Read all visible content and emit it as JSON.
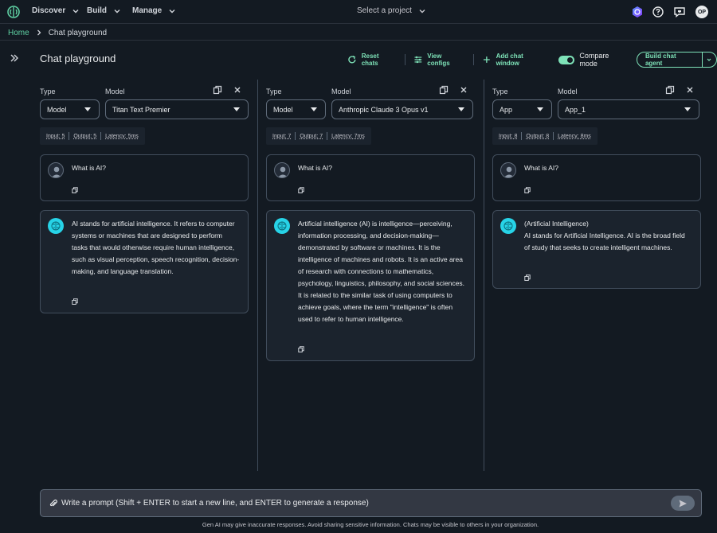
{
  "topnav": {
    "nav_items": [
      {
        "label": "Discover"
      },
      {
        "label": "Build"
      },
      {
        "label": "Manage"
      }
    ],
    "project_select": "Select a project",
    "user_initials": "OP",
    "icons": [
      "logo-icon",
      "shield-badge-icon",
      "help-icon",
      "feedback-icon"
    ]
  },
  "breadcrumb": {
    "home": "Home",
    "current": "Chat playground"
  },
  "header": {
    "title": "Chat playground",
    "reset_chats": "Reset chats",
    "view_configs": "View configs",
    "add_chat_window": "Add chat window",
    "compare_mode": "Compare mode",
    "compare_mode_on": true,
    "build_chat_agent": "Build chat agent"
  },
  "colors": {
    "accent": "#7ee2b8",
    "link": "#5fd0a3",
    "background": "#131a22",
    "ai_avatar": "#27d3e7"
  },
  "labels": {
    "type": "Type",
    "model": "Model"
  },
  "columns": [
    {
      "type": "Model",
      "model": "Titan Text Premier",
      "metrics": {
        "input": "Input: 5",
        "output": "Output: 5",
        "latency": "Latency: 5ms"
      },
      "user_message": "What is AI?",
      "ai_message": "AI stands for artificial intelligence. It refers to computer systems or machines that are designed to perform tasks that would otherwise require human intelligence, such as visual perception, speech recognition, decision-making, and language translation."
    },
    {
      "type": "Model",
      "model": "Anthropic Claude 3 Opus v1",
      "metrics": {
        "input": "Input: 7",
        "output": "Output: 7",
        "latency": "Latency: 7ms"
      },
      "user_message": "What is AI?",
      "ai_message": "Artificial intelligence (AI) is intelligence—perceiving, information processing, and decision-making—demonstrated by software or machines. It is the intelligence of machines and robots. It is an active area of research with connections to mathematics, psychology, linguistics, philosophy, and social sciences. It is related to the similar task of using computers to achieve goals, where the term \"intelligence\" is often used to refer to human intelligence."
    },
    {
      "type": "App",
      "model": "App_1",
      "metrics": {
        "input": "Input: 8",
        "output": "Output: 8",
        "latency": "Latency: 8ms"
      },
      "user_message": "What is AI?",
      "ai_message_title": "(Artificial Intelligence)",
      "ai_message": "AI stands for Artificial Intelligence. AI is the broad field of study that seeks to create intelligent machines."
    }
  ],
  "prompt": {
    "placeholder": "Write a prompt (Shift + ENTER to start a new line, and ENTER to generate a response)"
  },
  "disclaimer": "Gen AI may give inaccurate responses. Avoid sharing sensitive information. Chats may be visible to others in your organization."
}
